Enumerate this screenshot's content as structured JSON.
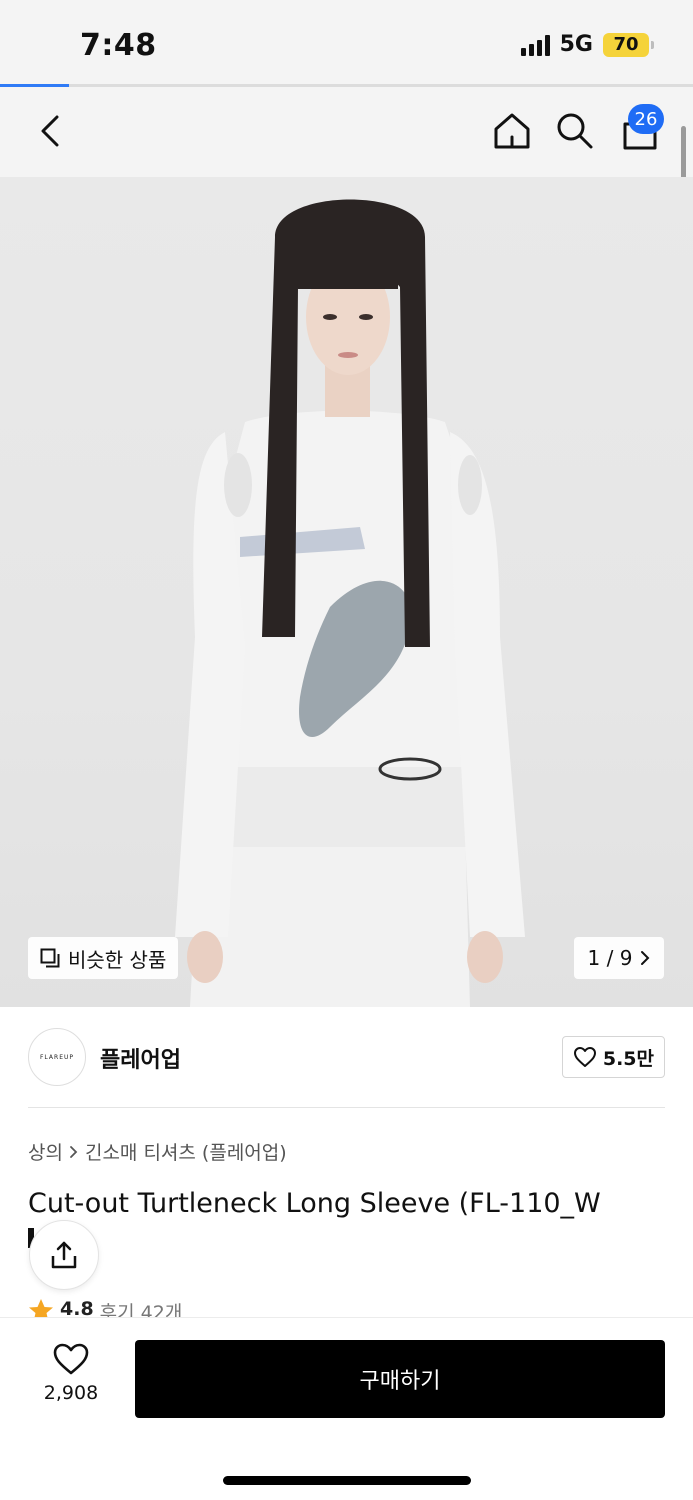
{
  "status_bar": {
    "time": "7:48",
    "network": "5G",
    "battery": "70"
  },
  "page_load_progress": 0.1,
  "nav": {
    "back_icon": "chevron-left-icon",
    "home_icon": "home-icon",
    "search_icon": "search-icon",
    "cart_icon": "shopping-bag-icon",
    "cart_count": "26"
  },
  "gallery": {
    "similar_label": "비슷한 상품",
    "counter": "1 / 9"
  },
  "brand": {
    "logo_text": "FLAREUP",
    "name": "플레어업",
    "likes": "5.5만"
  },
  "breadcrumb": {
    "category": "상의",
    "subcategory": "긴소매 티셔츠 (플레어업)"
  },
  "product": {
    "title": "Cut-out Turtleneck Long Sleeve (FL-110_W",
    "rating": "4.8",
    "reviews": "후기 42개"
  },
  "bottom": {
    "wish_count": "2,908",
    "buy_label": "구매하기"
  },
  "colors": {
    "accent": "#1f6cf5",
    "buy_button": "#000000",
    "star": "#f5a623",
    "battery": "#f5d33a"
  }
}
